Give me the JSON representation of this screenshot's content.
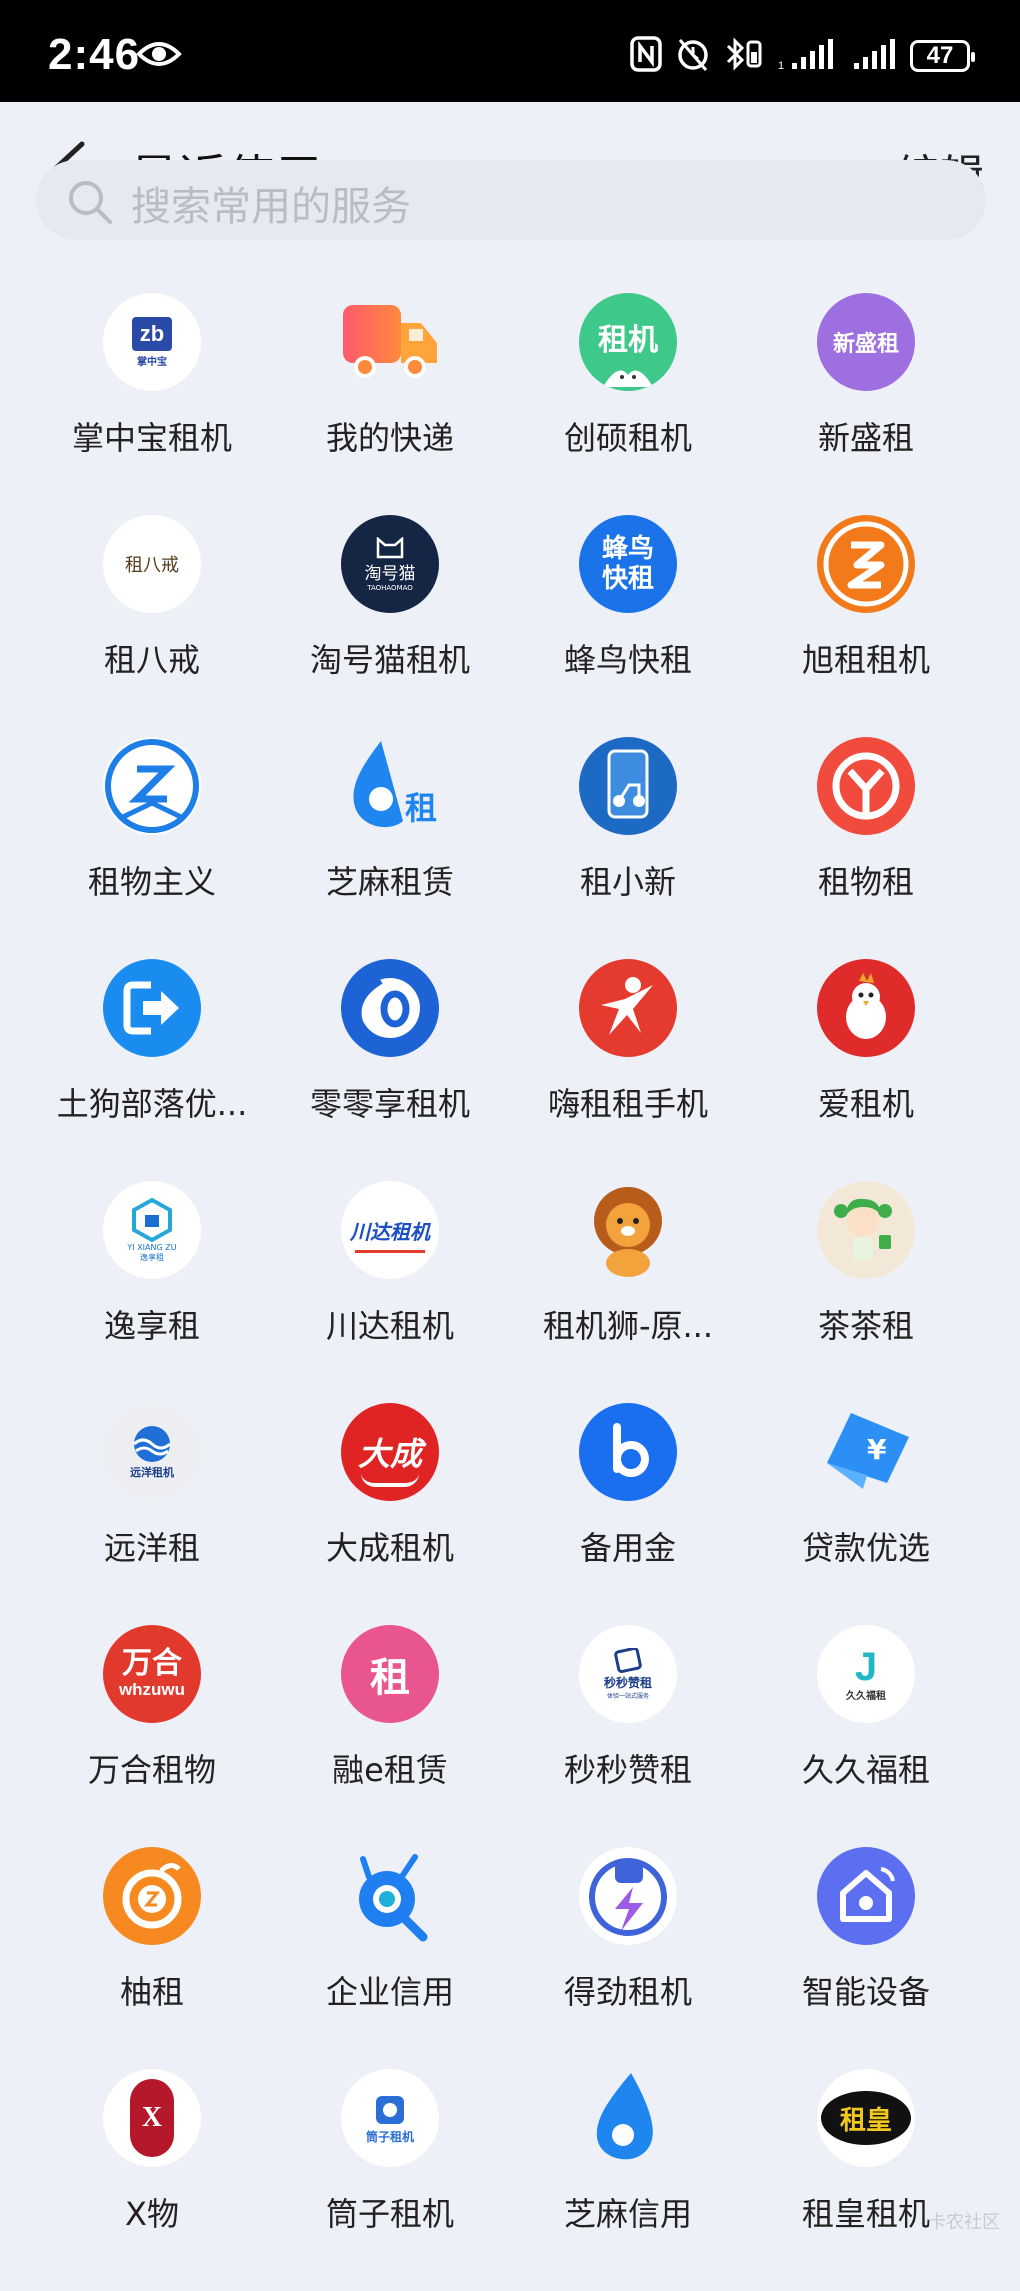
{
  "status_bar": {
    "time": "2:46",
    "battery": "47"
  },
  "header": {
    "title": "最近使用",
    "edit_label": "编辑"
  },
  "search": {
    "placeholder": "搜索常用的服务"
  },
  "apps": [
    {
      "label": "掌中宝租机",
      "icon": "zb-icon",
      "mark": "zb",
      "sub": "掌中宝"
    },
    {
      "label": "我的快递",
      "icon": "truck-icon"
    },
    {
      "label": "创硕租机",
      "icon": "chuangshuo-icon",
      "mark": "租机"
    },
    {
      "label": "新盛租",
      "icon": "xinsheng-icon",
      "mark": "新盛租"
    },
    {
      "label": "租八戒",
      "icon": "zubajie-icon",
      "mark": "租八戒"
    },
    {
      "label": "淘号猫租机",
      "icon": "taohaomao-icon",
      "mark": "淘号猫",
      "sub": "TAOHAOMAO"
    },
    {
      "label": "蜂鸟快租",
      "icon": "fengniao-icon",
      "mark": "蜂鸟",
      "mark2": "快租"
    },
    {
      "label": "旭租租机",
      "icon": "xuzu-icon"
    },
    {
      "label": "租物主义",
      "icon": "zuwu-z-icon"
    },
    {
      "label": "芝麻租赁",
      "icon": "zhima-zulin-icon",
      "mark": "租"
    },
    {
      "label": "租小新",
      "icon": "scooter-phone-icon"
    },
    {
      "label": "租物租",
      "icon": "y-logo-icon"
    },
    {
      "label": "土狗部落优...",
      "icon": "arrow-exit-icon"
    },
    {
      "label": "零零享租机",
      "icon": "zero-zero-icon"
    },
    {
      "label": "嗨租租手机",
      "icon": "runner-icon"
    },
    {
      "label": "爱租机",
      "icon": "chicken-icon"
    },
    {
      "label": "逸享租",
      "icon": "hexagon-icon",
      "sub": "YI XIANG ZU",
      "sub2": "逸享租"
    },
    {
      "label": "川达租机",
      "icon": "chuanda-icon",
      "mark": "川达租机"
    },
    {
      "label": "租机狮-原...",
      "icon": "lion-icon"
    },
    {
      "label": "茶茶租",
      "icon": "girl-icon"
    },
    {
      "label": "远洋租",
      "icon": "wave-icon",
      "mark": "远洋租机"
    },
    {
      "label": "大成租机",
      "icon": "dacheng-icon",
      "mark": "大成"
    },
    {
      "label": "备用金",
      "icon": "b-logo-icon"
    },
    {
      "label": "贷款优选",
      "icon": "yuan-card-icon"
    },
    {
      "label": "万合租物",
      "icon": "wanhe-icon",
      "mark": "万合",
      "sub": "whzuwu"
    },
    {
      "label": "融e租赁",
      "icon": "rong-zu-icon",
      "mark": "租"
    },
    {
      "label": "秒秒赞租",
      "icon": "miaomiao-icon",
      "mark": "秒秒赞租",
      "sub": "体验一站式服务"
    },
    {
      "label": "久久福租",
      "icon": "jiujiu-icon",
      "mark": "J",
      "sub": "久久福租"
    },
    {
      "label": "柚租",
      "icon": "youzu-icon"
    },
    {
      "label": "企业信用",
      "icon": "magnifier-bug-icon"
    },
    {
      "label": "得劲租机",
      "icon": "fist-bolt-icon"
    },
    {
      "label": "智能设备",
      "icon": "smart-home-icon"
    },
    {
      "label": "X物",
      "icon": "x-seal-icon",
      "mark": "X"
    },
    {
      "label": "筒子租机",
      "icon": "tongzi-icon",
      "mark": "筒子租机"
    },
    {
      "label": "芝麻信用",
      "icon": "sesame-drop-icon"
    },
    {
      "label": "租皇租机",
      "icon": "zuhuang-icon",
      "mark": "租皇"
    }
  ],
  "watermark": "卡农社区"
}
